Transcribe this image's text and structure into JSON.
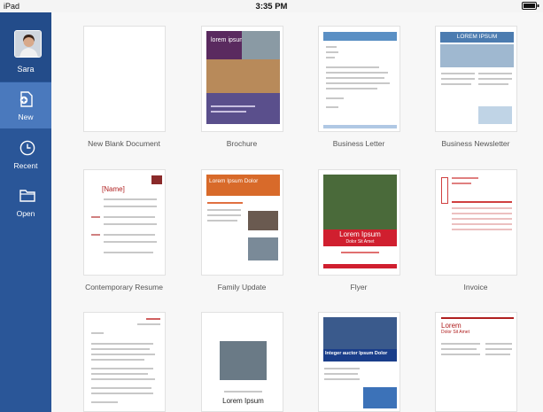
{
  "status_bar": {
    "device": "iPad",
    "time": "3:35 PM"
  },
  "sidebar": {
    "account_name": "Sara",
    "items": [
      {
        "label": "New",
        "icon": "new-document-icon",
        "active": true
      },
      {
        "label": "Recent",
        "icon": "clock-icon",
        "active": false
      },
      {
        "label": "Open",
        "icon": "folder-icon",
        "active": false
      }
    ]
  },
  "templates": [
    {
      "caption": "New Blank Document"
    },
    {
      "caption": "Brochure",
      "preview_text": "lorem ipsum"
    },
    {
      "caption": "Business Letter"
    },
    {
      "caption": "Business Newsletter",
      "preview_text": "LOREM IPSUM"
    },
    {
      "caption": "Contemporary Resume",
      "preview_text": "[Name]"
    },
    {
      "caption": "Family Update",
      "preview_text": "Lorem Ipsum Dolor"
    },
    {
      "caption": "Flyer",
      "preview_text": "Lorem Ipsum",
      "preview_sub": "Dolor Sit Amet"
    },
    {
      "caption": "Invoice"
    },
    {
      "caption": ""
    },
    {
      "caption": "",
      "preview_text": "Lorem Ipsum"
    },
    {
      "caption": "",
      "preview_text": "Integer auctor Ipsum Dolor"
    },
    {
      "caption": "",
      "preview_text": "Lorem",
      "preview_sub": "Dolor Sit Amet"
    }
  ],
  "colors": {
    "sidebar": "#2a5698",
    "active": "#4a79bd"
  }
}
